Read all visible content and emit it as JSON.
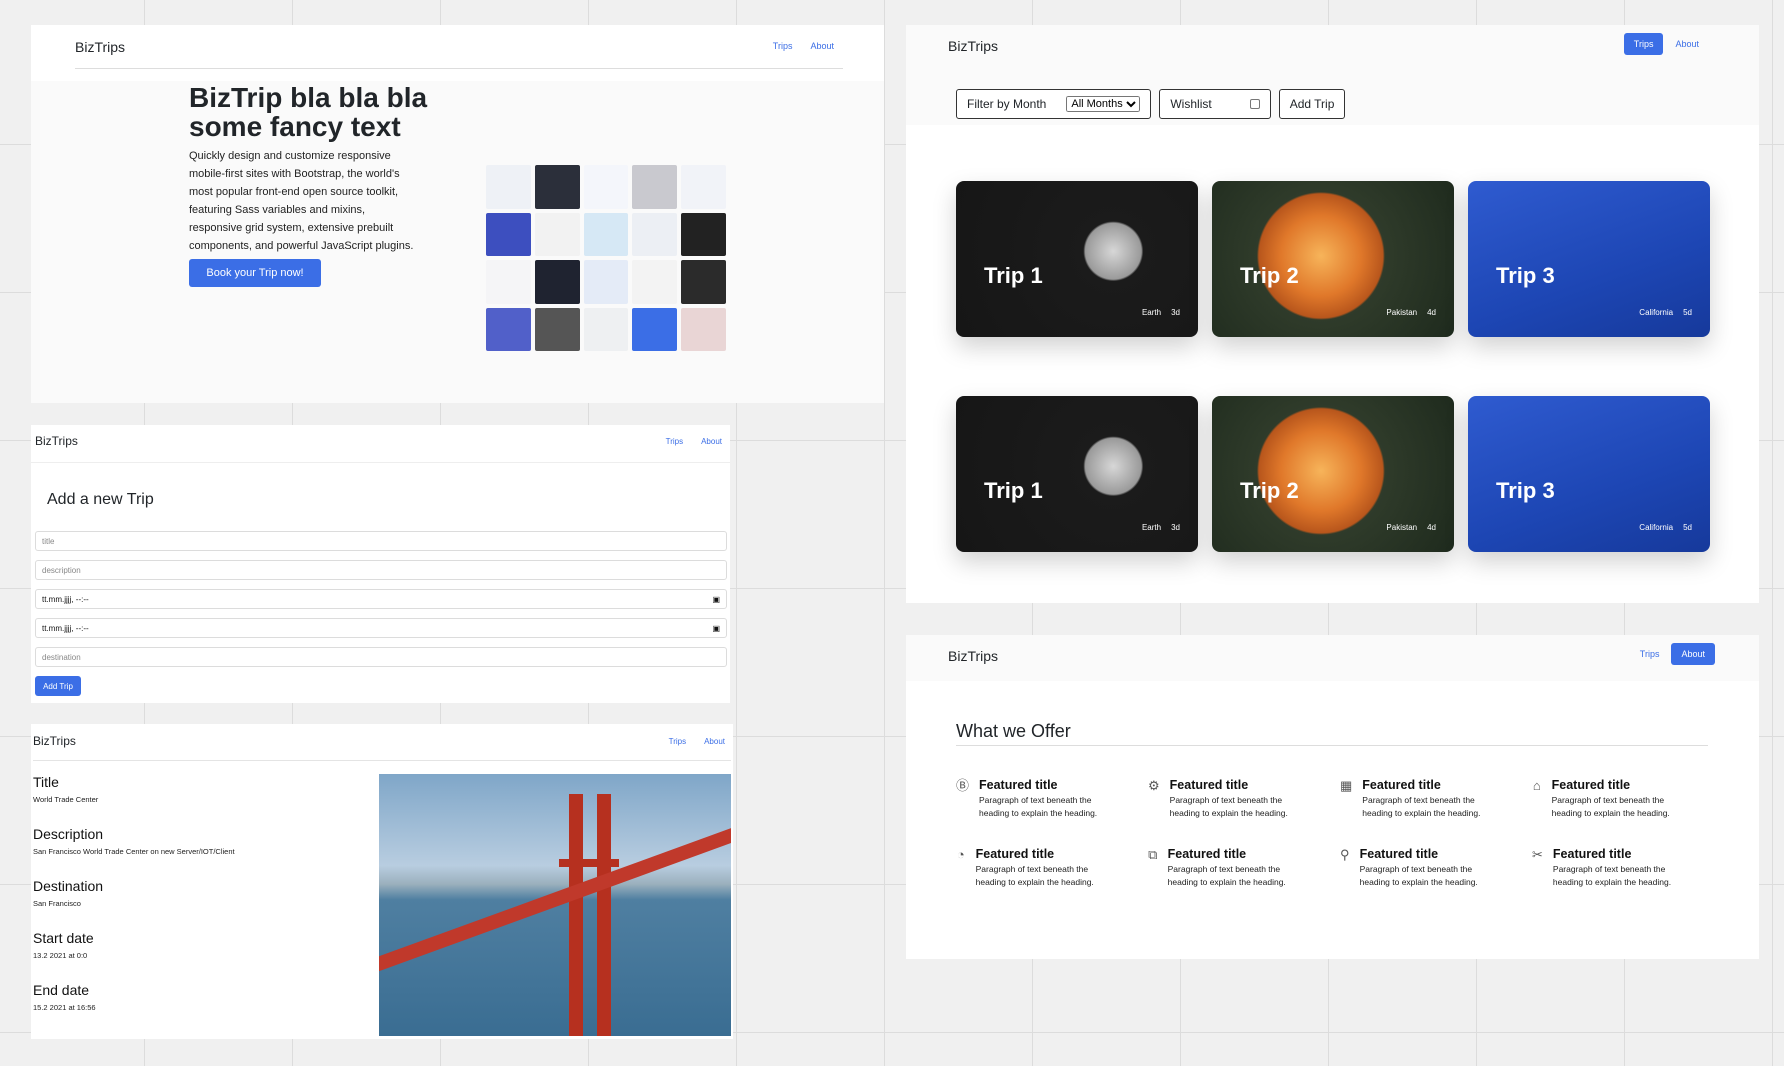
{
  "brand": "BizTrips",
  "nav": {
    "trips": "Trips",
    "about": "About"
  },
  "home": {
    "title": "BizTrip bla bla bla some fancy text",
    "lead": "Quickly design and customize responsive mobile-first sites with Bootstrap, the world's most popular front-end open source toolkit, featuring Sass variables and mixins, responsive grid system, extensive prebuilt components, and powerful JavaScript plugins.",
    "cta": "Book your Trip now!"
  },
  "trips": {
    "filter_label": "Filter by Month",
    "filter_value": "All Months",
    "wishlist": "Wishlist",
    "add_trip": "Add Trip",
    "cards": [
      {
        "title": "Trip 1",
        "place": "Earth",
        "days": "3d"
      },
      {
        "title": "Trip 2",
        "place": "Pakistan",
        "days": "4d"
      },
      {
        "title": "Trip 3",
        "place": "California",
        "days": "5d"
      }
    ]
  },
  "add_form": {
    "heading": "Add a new Trip",
    "title_ph": "title",
    "desc_ph": "description",
    "date1": "tt.mm.jjjj, --:--",
    "date2": "tt.mm.jjjj, --:--",
    "dest_ph": "destination",
    "submit": "Add Trip"
  },
  "detail": {
    "title_k": "Title",
    "title_v": "World Trade Center",
    "desc_k": "Description",
    "desc_v": "San Francisco World Trade Center on new Server/IOT/Client",
    "dest_k": "Destination",
    "dest_v": "San Francisco",
    "start_k": "Start date",
    "start_v": "13.2 2021 at 0:0",
    "end_k": "End date",
    "end_v": "15.2 2021 at 16:56"
  },
  "about": {
    "heading": "What we Offer",
    "feature_title": "Featured title",
    "feature_text": "Paragraph of text beneath the heading to explain the heading.",
    "icons": [
      "bootstrap-icon",
      "cpu-icon",
      "calendar-icon",
      "home-icon",
      "speedometer-icon",
      "toggles-icon",
      "geo-icon",
      "tools-icon"
    ]
  }
}
